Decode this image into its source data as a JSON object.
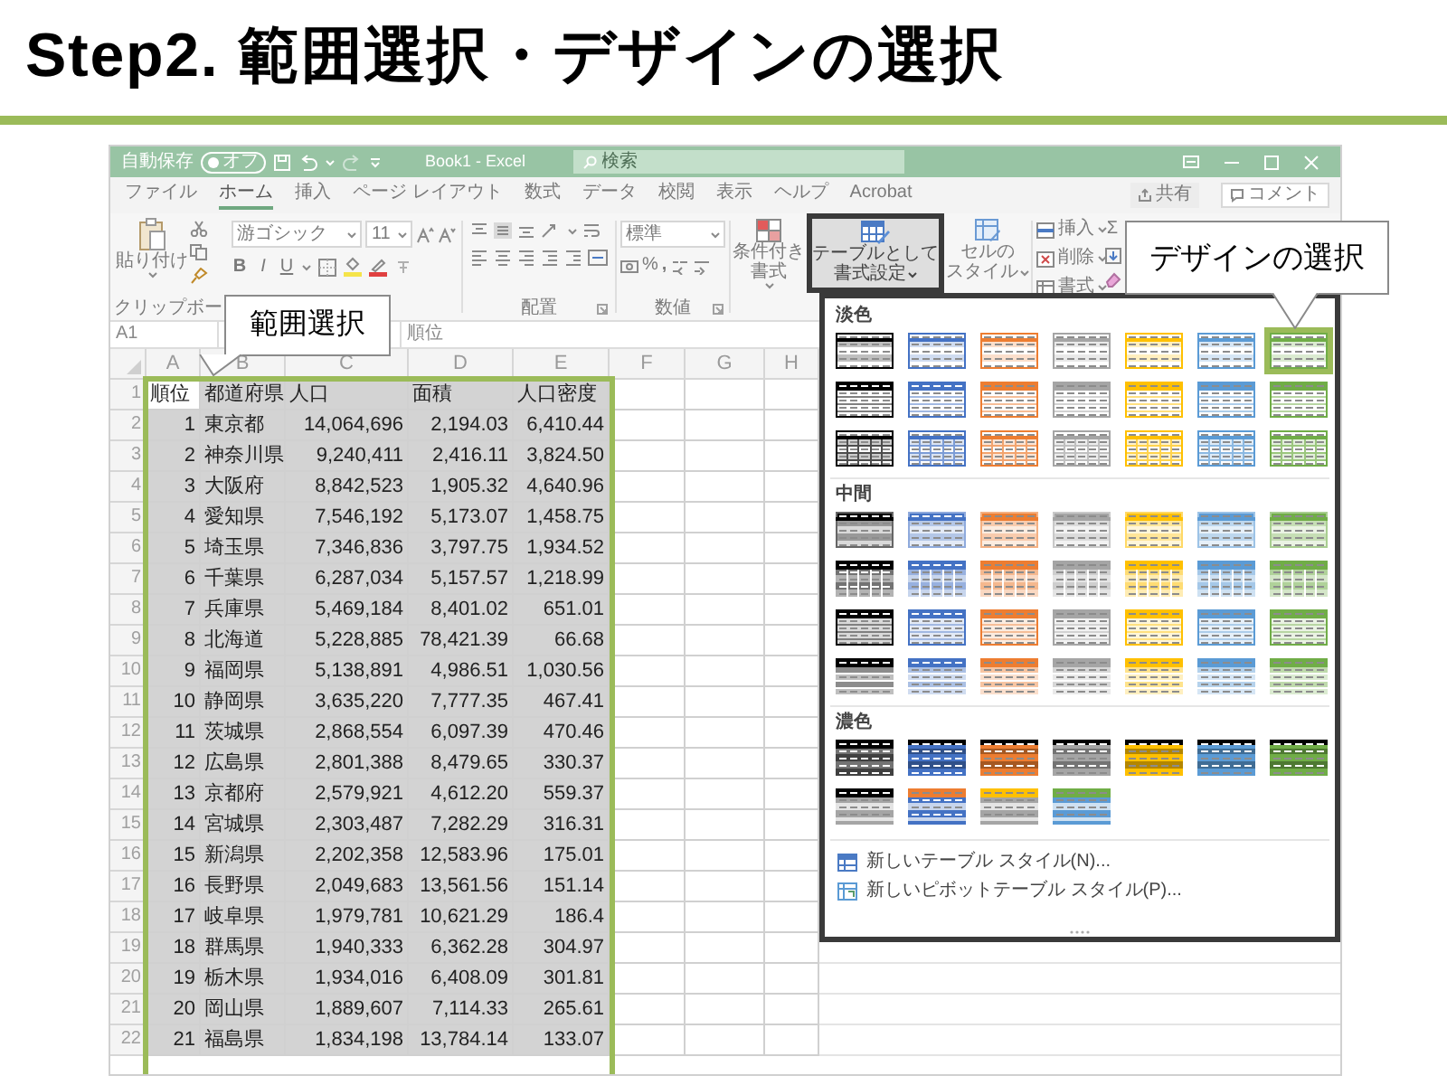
{
  "slide_title": "Step2. 範囲選択・デザインの選択",
  "title_bar": {
    "autosave_label": "自動保存",
    "autosave_state": "オフ",
    "autosave_on": false,
    "document_title": "Book1 - Excel",
    "search_placeholder": "検索"
  },
  "tabs": [
    {
      "label": "ファイル",
      "selected": false
    },
    {
      "label": "ホーム",
      "selected": true
    },
    {
      "label": "挿入",
      "selected": false
    },
    {
      "label": "ページ レイアウト",
      "selected": false
    },
    {
      "label": "数式",
      "selected": false
    },
    {
      "label": "データ",
      "selected": false
    },
    {
      "label": "校閲",
      "selected": false
    },
    {
      "label": "表示",
      "selected": false
    },
    {
      "label": "ヘルプ",
      "selected": false
    },
    {
      "label": "Acrobat",
      "selected": false
    }
  ],
  "share_button": "共有",
  "comment_button": "コメント",
  "ribbon": {
    "paste": "貼り付け",
    "font_name": "游ゴシック",
    "font_size": "11",
    "bold": "B",
    "italic": "I",
    "underline": "U",
    "number_format": "標準",
    "percent": "%",
    "comma": ",",
    "conditional_format": [
      "条件付き",
      "書式"
    ],
    "format_as_table": [
      "テーブルとして",
      "書式設定"
    ],
    "cell_styles": [
      "セルの",
      "スタイル"
    ],
    "cells": [
      "挿入",
      "削除",
      "書式"
    ],
    "autosum": "Σ",
    "group_labels": [
      "クリップボー",
      "配置",
      "数値"
    ]
  },
  "formula_bar": {
    "cell_ref": "A1",
    "content": "順位"
  },
  "sheet": {
    "columns": [
      "A",
      "B",
      "C",
      "D",
      "E",
      "F",
      "G",
      "H"
    ],
    "rows": [
      {
        "number": "1",
        "selected": true,
        "cells": [
          "順位",
          "都道府県",
          "人口",
          "面積",
          "人口密度"
        ]
      },
      {
        "number": "2",
        "selected": true,
        "cells": [
          "1",
          "東京都",
          "14,064,696",
          "2,194.03",
          "6,410.44"
        ]
      },
      {
        "number": "3",
        "selected": true,
        "cells": [
          "2",
          "神奈川県",
          "9,240,411",
          "2,416.11",
          "3,824.50"
        ]
      },
      {
        "number": "4",
        "selected": true,
        "cells": [
          "3",
          "大阪府",
          "8,842,523",
          "1,905.32",
          "4,640.96"
        ]
      },
      {
        "number": "5",
        "selected": true,
        "cells": [
          "4",
          "愛知県",
          "7,546,192",
          "5,173.07",
          "1,458.75"
        ]
      },
      {
        "number": "6",
        "selected": true,
        "cells": [
          "5",
          "埼玉県",
          "7,346,836",
          "3,797.75",
          "1,934.52"
        ]
      },
      {
        "number": "7",
        "selected": true,
        "cells": [
          "6",
          "千葉県",
          "6,287,034",
          "5,157.57",
          "1,218.99"
        ]
      },
      {
        "number": "8",
        "selected": true,
        "cells": [
          "7",
          "兵庫県",
          "5,469,184",
          "8,401.02",
          "651.01"
        ]
      },
      {
        "number": "9",
        "selected": true,
        "cells": [
          "8",
          "北海道",
          "5,228,885",
          "78,421.39",
          "66.68"
        ]
      },
      {
        "number": "10",
        "selected": true,
        "cells": [
          "9",
          "福岡県",
          "5,138,891",
          "4,986.51",
          "1,030.56"
        ]
      },
      {
        "number": "11",
        "selected": true,
        "cells": [
          "10",
          "静岡県",
          "3,635,220",
          "7,777.35",
          "467.41"
        ]
      },
      {
        "number": "12",
        "selected": true,
        "cells": [
          "11",
          "茨城県",
          "2,868,554",
          "6,097.39",
          "470.46"
        ]
      },
      {
        "number": "13",
        "selected": true,
        "cells": [
          "12",
          "広島県",
          "2,801,388",
          "8,479.65",
          "330.37"
        ]
      },
      {
        "number": "14",
        "selected": true,
        "cells": [
          "13",
          "京都府",
          "2,579,921",
          "4,612.20",
          "559.37"
        ]
      },
      {
        "number": "15",
        "selected": true,
        "cells": [
          "14",
          "宮城県",
          "2,303,487",
          "7,282.29",
          "316.31"
        ]
      },
      {
        "number": "16",
        "selected": true,
        "cells": [
          "15",
          "新潟県",
          "2,202,358",
          "12,583.96",
          "175.01"
        ]
      },
      {
        "number": "17",
        "selected": true,
        "cells": [
          "16",
          "長野県",
          "2,049,683",
          "13,561.56",
          "151.14"
        ]
      },
      {
        "number": "18",
        "selected": true,
        "cells": [
          "17",
          "岐阜県",
          "1,979,781",
          "10,621.29",
          "186.4"
        ]
      },
      {
        "number": "19",
        "selected": true,
        "cells": [
          "18",
          "群馬県",
          "1,940,333",
          "6,362.28",
          "304.97"
        ]
      },
      {
        "number": "20",
        "selected": true,
        "cells": [
          "19",
          "栃木県",
          "1,934,016",
          "6,408.09",
          "301.81"
        ]
      },
      {
        "number": "21",
        "selected": true,
        "cells": [
          "20",
          "岡山県",
          "1,889,607",
          "7,114.33",
          "265.61"
        ]
      },
      {
        "number": "22",
        "selected": true,
        "cells": [
          "21",
          "福島県",
          "1,834,198",
          "13,784.14",
          "133.07"
        ]
      }
    ]
  },
  "callouts": [
    "範囲選択",
    "デザインの選択"
  ],
  "table_styles": {
    "sections": [
      {
        "title": "淡色",
        "rows": [
          {
            "kind": "light-banded",
            "swatches": [
              {
                "color": "#000000",
                "selected": false
              },
              {
                "color": "#4472c4",
                "selected": false
              },
              {
                "color": "#ed7d31",
                "selected": false
              },
              {
                "color": "#a5a5a5",
                "selected": false
              },
              {
                "color": "#ffc000",
                "selected": false
              },
              {
                "color": "#5b9bd5",
                "selected": false
              },
              {
                "color": "#70ad47",
                "selected": true
              }
            ]
          },
          {
            "kind": "light-header",
            "swatches": [
              {
                "color": "#000000",
                "selected": false
              },
              {
                "color": "#4472c4",
                "selected": false
              },
              {
                "color": "#ed7d31",
                "selected": false
              },
              {
                "color": "#a5a5a5",
                "selected": false
              },
              {
                "color": "#ffc000",
                "selected": false
              },
              {
                "color": "#5b9bd5",
                "selected": false
              },
              {
                "color": "#70ad47",
                "selected": false
              }
            ]
          },
          {
            "kind": "light-grid",
            "swatches": [
              {
                "color": "#000000",
                "selected": false
              },
              {
                "color": "#4472c4",
                "selected": false
              },
              {
                "color": "#ed7d31",
                "selected": false
              },
              {
                "color": "#a5a5a5",
                "selected": false
              },
              {
                "color": "#ffc000",
                "selected": false
              },
              {
                "color": "#5b9bd5",
                "selected": false
              },
              {
                "color": "#70ad47",
                "selected": false
              }
            ]
          }
        ]
      },
      {
        "title": "中間",
        "rows": [
          {
            "kind": "medium-banded",
            "swatches": [
              {
                "color": "#000000",
                "selected": false
              },
              {
                "color": "#4472c4",
                "selected": false
              },
              {
                "color": "#ed7d31",
                "selected": false
              },
              {
                "color": "#a5a5a5",
                "selected": false
              },
              {
                "color": "#ffc000",
                "selected": false
              },
              {
                "color": "#5b9bd5",
                "selected": false
              },
              {
                "color": "#70ad47",
                "selected": false
              }
            ]
          },
          {
            "kind": "medium-strong",
            "swatches": [
              {
                "color": "#000000",
                "selected": false
              },
              {
                "color": "#4472c4",
                "selected": false
              },
              {
                "color": "#ed7d31",
                "selected": false
              },
              {
                "color": "#a5a5a5",
                "selected": false
              },
              {
                "color": "#ffc000",
                "selected": false
              },
              {
                "color": "#5b9bd5",
                "selected": false
              },
              {
                "color": "#70ad47",
                "selected": false
              }
            ]
          },
          {
            "kind": "medium-dark-header",
            "swatches": [
              {
                "color": "#000000",
                "selected": false
              },
              {
                "color": "#4472c4",
                "selected": false
              },
              {
                "color": "#ed7d31",
                "selected": false
              },
              {
                "color": "#a5a5a5",
                "selected": false
              },
              {
                "color": "#ffc000",
                "selected": false
              },
              {
                "color": "#5b9bd5",
                "selected": false
              },
              {
                "color": "#70ad47",
                "selected": false
              }
            ]
          },
          {
            "kind": "medium-tint",
            "swatches": [
              {
                "color": "#000000",
                "selected": false
              },
              {
                "color": "#4472c4",
                "selected": false
              },
              {
                "color": "#ed7d31",
                "selected": false
              },
              {
                "color": "#a5a5a5",
                "selected": false
              },
              {
                "color": "#ffc000",
                "selected": false
              },
              {
                "color": "#5b9bd5",
                "selected": false
              },
              {
                "color": "#70ad47",
                "selected": false
              }
            ]
          }
        ]
      },
      {
        "title": "濃色",
        "rows": [
          {
            "kind": "dark-banded",
            "swatches": [
              {
                "color": "#000000",
                "selected": false
              },
              {
                "color": "#4472c4",
                "selected": false
              },
              {
                "color": "#ed7d31",
                "selected": false
              },
              {
                "color": "#a5a5a5",
                "selected": false
              },
              {
                "color": "#ffc000",
                "selected": false
              },
              {
                "color": "#5b9bd5",
                "selected": false
              },
              {
                "color": "#70ad47",
                "selected": false
              }
            ]
          },
          {
            "kind": "dark-two-tone",
            "swatches": [
              {
                "header": {
                  "color": "#000000"
                },
                "body": {
                  "color": "#a5a5a5"
                },
                "selected": false
              },
              {
                "header": {
                  "color": "#ed7d31"
                },
                "body": {
                  "color": "#4472c4"
                },
                "selected": false
              },
              {
                "header": {
                  "color": "#ffc000"
                },
                "body": {
                  "color": "#a5a5a5"
                },
                "selected": false
              },
              {
                "header": {
                  "color": "#70ad47"
                },
                "body": {
                  "color": "#5b9bd5"
                },
                "selected": false
              }
            ]
          }
        ]
      }
    ],
    "menu": [
      "新しいテーブル スタイル(N)...",
      "新しいピボットテーブル スタイル(P)..."
    ]
  }
}
